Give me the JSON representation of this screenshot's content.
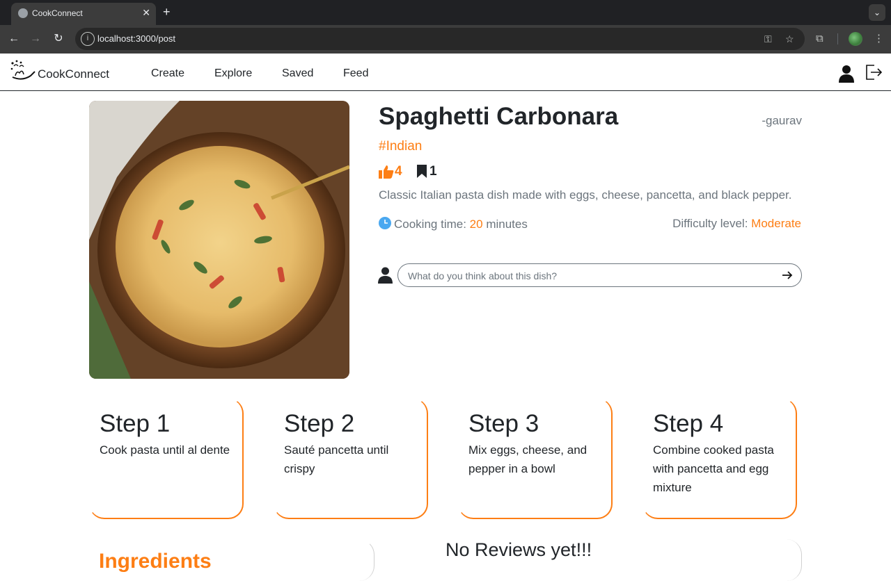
{
  "browser": {
    "tab_title": "CookConnect",
    "url": "localhost:3000/post"
  },
  "navbar": {
    "brand": "CookConnect",
    "links": [
      "Create",
      "Explore",
      "Saved",
      "Feed"
    ]
  },
  "post": {
    "title": "Spaghetti Carbonara",
    "author": "-gaurav",
    "tag": "#Indian",
    "likes": "4",
    "saves": "1",
    "description": "Classic Italian pasta dish made with eggs, cheese, pancetta, and black pepper.",
    "cooking_time_label": "Cooking time:",
    "cooking_time_value": "20",
    "cooking_time_unit": "minutes",
    "difficulty_label": "Difficulty level:",
    "difficulty_value": "Moderate",
    "comment_placeholder": "What do you think about this dish?"
  },
  "steps": [
    {
      "title": "Step 1",
      "text": "Cook pasta until al dente"
    },
    {
      "title": "Step 2",
      "text": "Sauté pancetta until crispy"
    },
    {
      "title": "Step 3",
      "text": "Mix eggs, cheese, and pepper in a bowl"
    },
    {
      "title": "Step 4",
      "text": "Combine cooked pasta with pancetta and egg mixture"
    }
  ],
  "ingredients": {
    "title": "Ingredients"
  },
  "reviews": {
    "title": "No Reviews yet!!!"
  },
  "colors": {
    "accent": "#fd7e14",
    "muted": "#6c757d",
    "text": "#212529",
    "clock": "#4aa8f0"
  },
  "icons": [
    "site-globe-icon",
    "close-icon",
    "plus-icon",
    "chevron-down-icon",
    "back-arrow-icon",
    "forward-arrow-icon",
    "reload-icon",
    "site-info-icon",
    "key-icon",
    "star-icon",
    "extensions-icon",
    "kebab-menu-icon",
    "cook-logo-icon",
    "user-icon",
    "logout-icon",
    "thumbs-up-icon",
    "bookmark-icon",
    "clock-icon",
    "send-arrow-icon"
  ]
}
